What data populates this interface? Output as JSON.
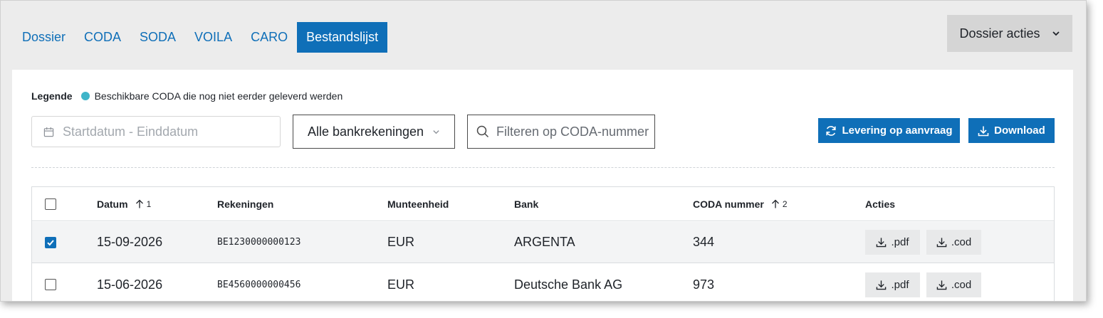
{
  "tabs": [
    {
      "label": "Dossier",
      "active": false
    },
    {
      "label": "CODA",
      "active": false
    },
    {
      "label": "SODA",
      "active": false
    },
    {
      "label": "VOILA",
      "active": false
    },
    {
      "label": "CARO",
      "active": false
    },
    {
      "label": "Bestandslijst",
      "active": true
    }
  ],
  "header": {
    "dossier_acties_label": "Dossier acties"
  },
  "legend": {
    "title": "Legende",
    "text": "Beschikbare CODA die nog niet eerder geleverd werden",
    "dot_color": "#3fb5c9"
  },
  "filters": {
    "date_placeholder": "Startdatum - Einddatum",
    "accounts_selected": "Alle bankrekeningen",
    "search_placeholder": "Filteren op CODA-nummer"
  },
  "buttons": {
    "levering_label": "Levering op aanvraag",
    "download_label": "Download"
  },
  "table": {
    "columns": {
      "datum": "Datum",
      "datum_sort_order": "1",
      "rekeningen": "Rekeningen",
      "munteenheid": "Munteenheid",
      "bank": "Bank",
      "coda_nummer": "CODA nummer",
      "coda_sort_order": "2",
      "acties": "Acties"
    },
    "rows": [
      {
        "checked": true,
        "datum": "15-09-2026",
        "rekening": "BE1230000000123",
        "munteenheid": "EUR",
        "bank": "ARGENTA",
        "coda_nummer": "344",
        "pdf_label": ".pdf",
        "cod_label": ".cod"
      },
      {
        "checked": false,
        "datum": "15-06-2026",
        "rekening": "BE4560000000456",
        "munteenheid": "EUR",
        "bank": "Deutsche Bank AG",
        "coda_nummer": "973",
        "pdf_label": ".pdf",
        "cod_label": ".cod"
      }
    ]
  },
  "colors": {
    "accent": "#0f6fb8",
    "legend_dot": "#3fb5c9"
  }
}
